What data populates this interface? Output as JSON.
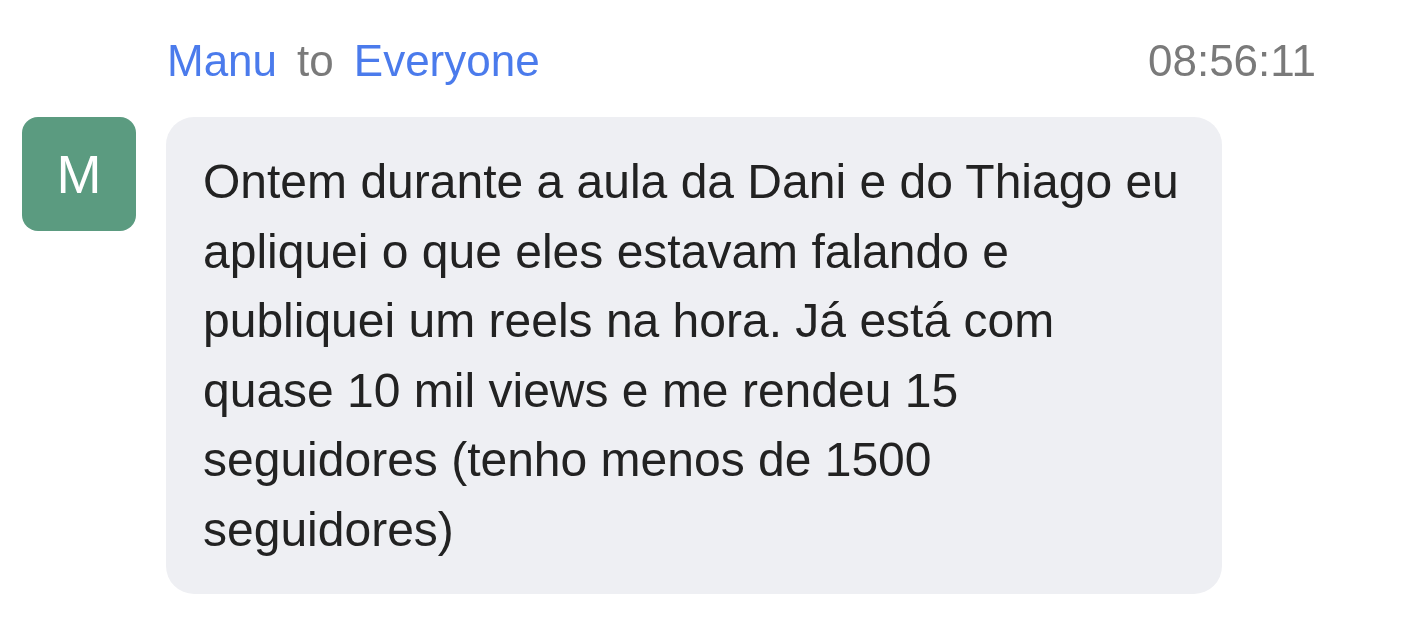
{
  "message": {
    "sender": "Manu",
    "connector": "to",
    "recipient": "Everyone",
    "time": "08:56:11",
    "avatar": {
      "initial": "M"
    },
    "text": "Ontem durante a aula da Dani e do Thiago eu apliquei o que eles estavam falando e publiquei um reels na hora. Já está com quase 10 mil views e me rendeu 15 seguidores (tenho menos de 1500 seguidores)"
  }
}
